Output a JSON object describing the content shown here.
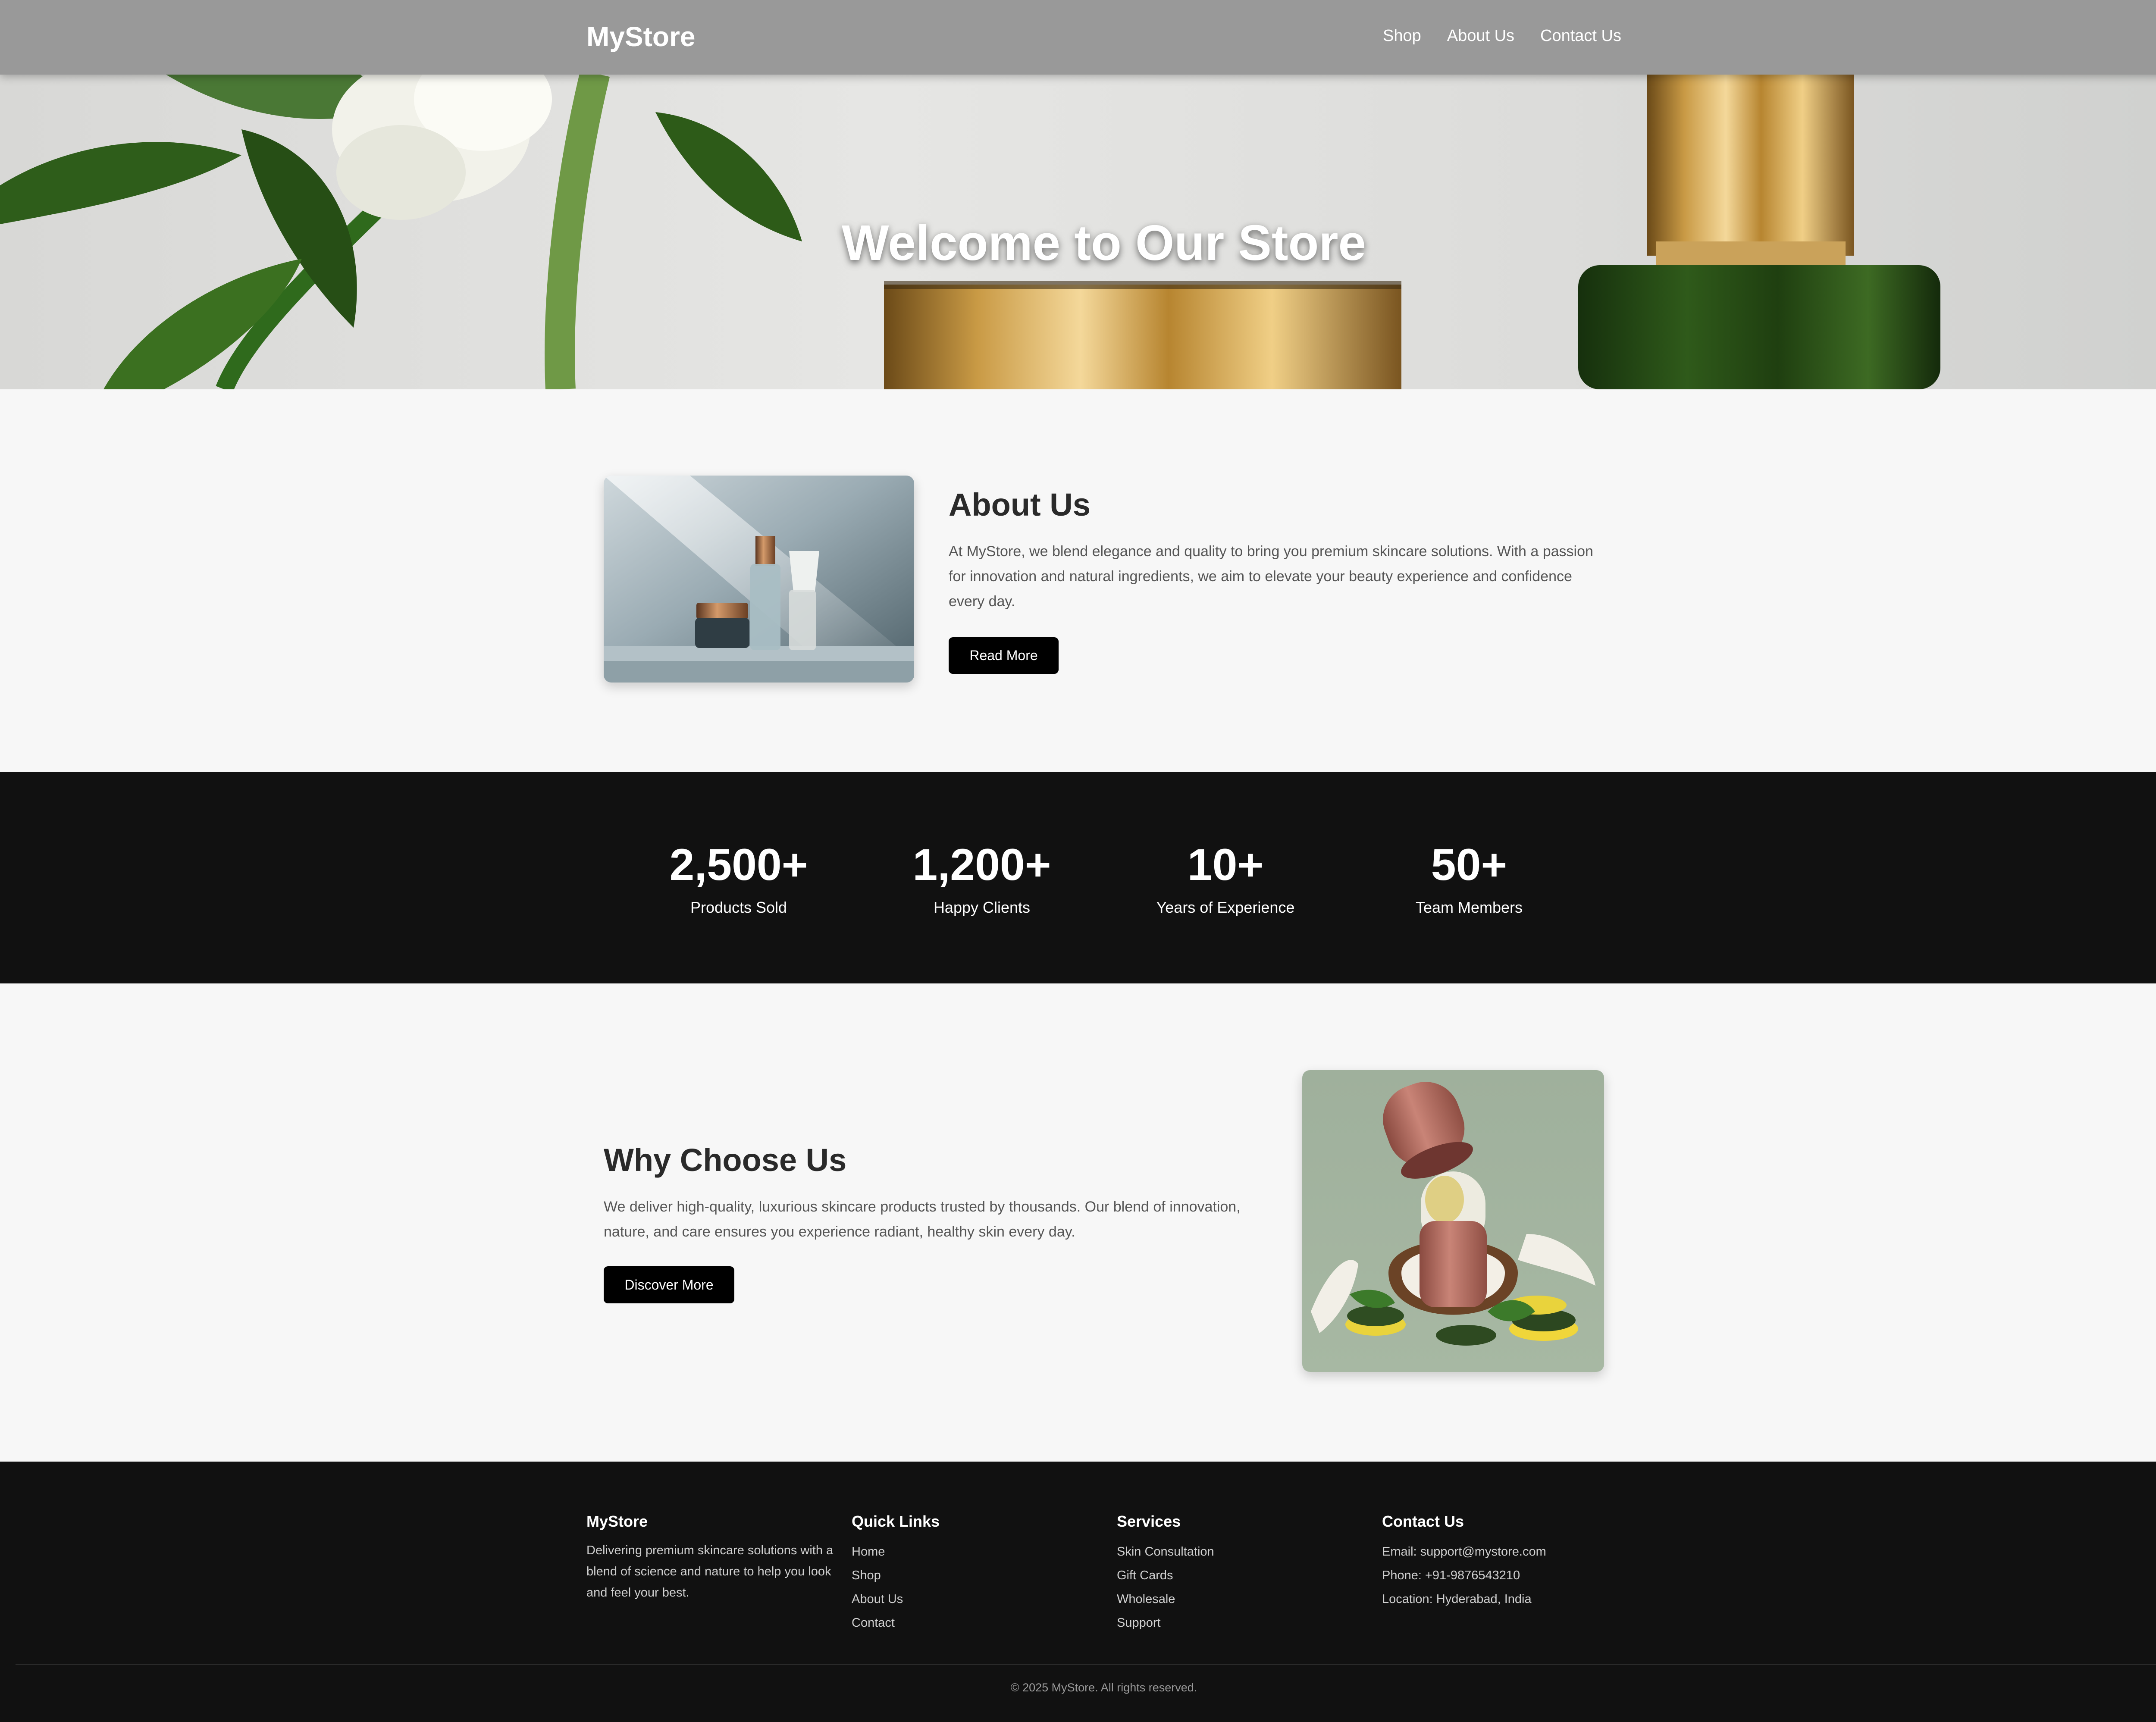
{
  "header": {
    "brand": "MyStore",
    "nav": [
      {
        "label": "Shop"
      },
      {
        "label": "About Us"
      },
      {
        "label": "Contact Us"
      }
    ]
  },
  "hero": {
    "title": "Welcome to Our Store"
  },
  "about": {
    "heading": "About Us",
    "text": "At MyStore, we blend elegance and quality to bring you premium skincare solutions. With a passion for innovation and natural ingredients, we aim to elevate your beauty experience and confidence every day.",
    "button": "Read More"
  },
  "stats": [
    {
      "value": "2,500+",
      "label": "Products Sold"
    },
    {
      "value": "1,200+",
      "label": "Happy Clients"
    },
    {
      "value": "10+",
      "label": "Years of Experience"
    },
    {
      "value": "50+",
      "label": "Team Members"
    }
  ],
  "why": {
    "heading": "Why Choose Us",
    "text": "We deliver high-quality, luxurious skincare products trusted by thousands. Our blend of innovation, nature, and care ensures you experience radiant, healthy skin every day.",
    "button": "Discover More"
  },
  "footer": {
    "brand": {
      "title": "MyStore",
      "text": "Delivering premium skincare solutions with a blend of science and nature to help you look and feel your best."
    },
    "quick_links": {
      "title": "Quick Links",
      "items": [
        "Home",
        "Shop",
        "About Us",
        "Contact"
      ]
    },
    "services": {
      "title": "Services",
      "items": [
        "Skin Consultation",
        "Gift Cards",
        "Wholesale",
        "Support"
      ]
    },
    "contact": {
      "title": "Contact Us",
      "items": [
        "Email: support@mystore.com",
        "Phone: +91-9876543210",
        "Location: Hyderabad, India"
      ]
    },
    "copyright": "© 2025 MyStore. All rights reserved."
  },
  "colors": {
    "nav_bg": "#999999",
    "dark_band": "#111111",
    "button": "#000000",
    "page_bg": "#f7f7f7"
  }
}
